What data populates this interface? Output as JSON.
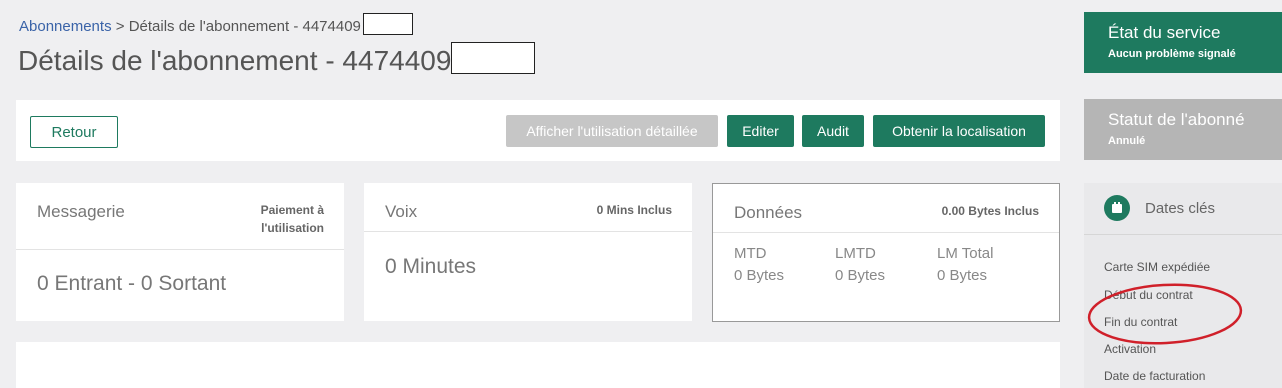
{
  "breadcrumb": {
    "root": "Abonnements",
    "separator": ">",
    "current": "Détails de l'abonnement - 4474409"
  },
  "header": {
    "title": "Détails de l'abonnement - 4474409"
  },
  "toolbar": {
    "back_label": "Retour",
    "usage_label": "Afficher l'utilisation détaillée",
    "edit_label": "Editer",
    "audit_label": "Audit",
    "location_label": "Obtenir la localisation"
  },
  "messaging": {
    "title": "Messagerie",
    "note": "Paiement à l'utilisation",
    "value": "0 Entrant - 0 Sortant"
  },
  "voice": {
    "title": "Voix",
    "note": "0 Mins Inclus",
    "value": "0 Minutes"
  },
  "data_usage": {
    "title": "Données",
    "note": "0.00 Bytes Inclus",
    "columns": [
      {
        "label": "MTD",
        "value": "0 Bytes"
      },
      {
        "label": "LMTD",
        "value": "0 Bytes"
      },
      {
        "label": "LM Total",
        "value": "0 Bytes"
      }
    ]
  },
  "service_status": {
    "title": "État du service",
    "subtitle": "Aucun problème signalé"
  },
  "subscriber_status": {
    "title": "Statut de l'abonné",
    "subtitle": "Annulé"
  },
  "key_dates": {
    "title": "Dates clés",
    "items": [
      "Carte SIM expédiée",
      "Début du contrat",
      "Fin du contrat",
      "Activation",
      "Date de facturation"
    ]
  },
  "colors": {
    "primary": "#1e7a5f",
    "disabled": "#c6c6c6",
    "link": "#3a63a8",
    "annotation": "#d0202a"
  },
  "icons": {
    "calendar": "calendar-icon"
  }
}
